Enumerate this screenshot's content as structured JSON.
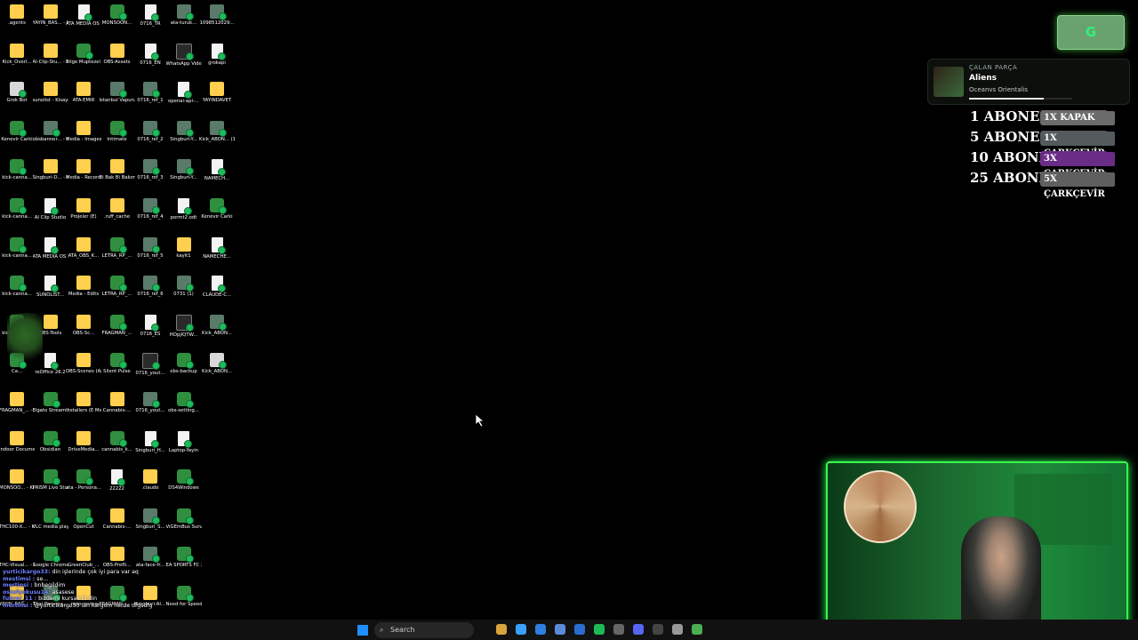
{
  "desktop": {
    "icons": [
      {
        "label": ".agents",
        "kind": "folder"
      },
      {
        "label": "YAYIN_BAS... - Kisayol",
        "kind": "folder"
      },
      {
        "label": "ATA MEDIA OS 3.0",
        "kind": "doc"
      },
      {
        "label": "MONSOON...",
        "kind": "app"
      },
      {
        "label": "0716_TR",
        "kind": "doc"
      },
      {
        "label": "ata-turuk...",
        "kind": "img"
      },
      {
        "label": "1098512029...",
        "kind": "img"
      },
      {
        "label": "Kick_Overl...",
        "kind": "folder"
      },
      {
        "label": "AI-Clip-Stu... - Kisayol",
        "kind": "folder"
      },
      {
        "label": "Bilge Muptezel ...",
        "kind": "app"
      },
      {
        "label": "OBS-Assets",
        "kind": "folder"
      },
      {
        "label": "0716_EN",
        "kind": "doc"
      },
      {
        "label": "WhatsApp Video 2026-...",
        "kind": "vid"
      },
      {
        "label": "grokapi",
        "kind": "doc"
      },
      {
        "label": "Grok Bot",
        "kind": "exe"
      },
      {
        "label": "sunolist - Kisayol",
        "kind": "folder"
      },
      {
        "label": "ATA-EMIR",
        "kind": "folder"
      },
      {
        "label": "İstanbul Vapuru",
        "kind": "img"
      },
      {
        "label": "0716_ref_1",
        "kind": "img"
      },
      {
        "label": "openai-api-...",
        "kind": "doc"
      },
      {
        "label": "YAYINDAVET",
        "kind": "folder"
      },
      {
        "label": "Kenevir Carki",
        "kind": "app"
      },
      {
        "label": "obsbanner... - Kisayol",
        "kind": "img"
      },
      {
        "label": "Media - Images",
        "kind": "folder"
      },
      {
        "label": "Intimate",
        "kind": "app"
      },
      {
        "label": "0716_ref_2",
        "kind": "img"
      },
      {
        "label": "Singburi-Y...",
        "kind": "img"
      },
      {
        "label": "Kick_ABON... (1)",
        "kind": "img"
      },
      {
        "label": "kick-canna...",
        "kind": "app"
      },
      {
        "label": "Singburi-D... - Kisayol",
        "kind": "folder"
      },
      {
        "label": "Media - Recordin...",
        "kind": "folder"
      },
      {
        "label": "Bi Bak Bi Bakım",
        "kind": "folder"
      },
      {
        "label": "0716_ref_3",
        "kind": "img"
      },
      {
        "label": "Singburi-Y...",
        "kind": "img"
      },
      {
        "label": "NAMECH...",
        "kind": "doc"
      },
      {
        "label": "kick-canna...",
        "kind": "app"
      },
      {
        "label": "AI Clip Studio",
        "kind": "doc"
      },
      {
        "label": "Projeler (E)",
        "kind": "folder"
      },
      {
        "label": ".ruff_cache",
        "kind": "folder"
      },
      {
        "label": "0716_ref_4",
        "kind": "img"
      },
      {
        "label": "pormt2.odt",
        "kind": "doc"
      },
      {
        "label": "Kenevir Carki",
        "kind": "app"
      },
      {
        "label": "kick-canna...",
        "kind": "app"
      },
      {
        "label": "ATA MEDIA OS 3.0",
        "kind": "doc"
      },
      {
        "label": "ATA_OBS_K...",
        "kind": "folder"
      },
      {
        "label": "LETRA_RP_...",
        "kind": "app"
      },
      {
        "label": "0716_ref_5",
        "kind": "img"
      },
      {
        "label": "kayit1",
        "kind": "folder"
      },
      {
        "label": "NAMECHE...",
        "kind": "doc"
      },
      {
        "label": "kick-canna...",
        "kind": "app"
      },
      {
        "label": "SUNOLIST...",
        "kind": "doc"
      },
      {
        "label": "Media - Edits",
        "kind": "folder"
      },
      {
        "label": "LETRA_RP_...",
        "kind": "app"
      },
      {
        "label": "0716_ref_6",
        "kind": "img"
      },
      {
        "label": "0731 (1)",
        "kind": "img"
      },
      {
        "label": "CLAUDE-C...",
        "kind": "doc"
      },
      {
        "label": "kick-canna...",
        "kind": "app"
      },
      {
        "label": "OBS-Tools",
        "kind": "folder"
      },
      {
        "label": "OBS-Sc...",
        "kind": "folder"
      },
      {
        "label": "FRAGMAN_...",
        "kind": "app"
      },
      {
        "label": "0716_ES",
        "kind": "doc"
      },
      {
        "label": "HOpjlQTW...",
        "kind": "vid"
      },
      {
        "label": "Kick_ABON...",
        "kind": "img"
      },
      {
        "label": "Ca...",
        "kind": "app"
      },
      {
        "label": "reOffice 26.2",
        "kind": "doc"
      },
      {
        "label": "OBS-Scenes (AppData)",
        "kind": "folder"
      },
      {
        "label": "Silent Pulse",
        "kind": "app"
      },
      {
        "label": "0716_yout...",
        "kind": "vid"
      },
      {
        "label": "obs-backup",
        "kind": "app"
      },
      {
        "label": "Kick_ABON...",
        "kind": "exe"
      },
      {
        "label": "FRAGMAN_... - Kisayol",
        "kind": "folder"
      },
      {
        "label": "Elgato Stream Deck",
        "kind": "app"
      },
      {
        "label": "Installers (E Media)",
        "kind": "folder"
      },
      {
        "label": "Cannabis-...",
        "kind": "folder"
      },
      {
        "label": "0716_yout...",
        "kind": "img"
      },
      {
        "label": "obs-setting...",
        "kind": "app"
      },
      {
        "label": "",
        "kind": "none"
      },
      {
        "label": "Indoor Document...",
        "kind": "folder"
      },
      {
        "label": "Obsidian",
        "kind": "app"
      },
      {
        "label": "DriveMedia...",
        "kind": "folder"
      },
      {
        "label": "cannabis_k...",
        "kind": "app"
      },
      {
        "label": "Singburi_H...",
        "kind": "doc"
      },
      {
        "label": "Laptop-Yayin",
        "kind": "doc"
      },
      {
        "label": "",
        "kind": "none"
      },
      {
        "label": "MONSOO... - Kisayol",
        "kind": "folder"
      },
      {
        "label": "PRISM Live Studio",
        "kind": "app"
      },
      {
        "label": "ata - Persona...",
        "kind": "app"
      },
      {
        "label": "22222",
        "kind": "doc"
      },
      {
        "label": ".claude",
        "kind": "folder"
      },
      {
        "label": "DS4Windows",
        "kind": "app"
      },
      {
        "label": "",
        "kind": "none"
      },
      {
        "label": "THC100-X... - Kisayol",
        "kind": "folder"
      },
      {
        "label": "VLC media player",
        "kind": "app"
      },
      {
        "label": "OpenCut",
        "kind": "app"
      },
      {
        "label": "Cannabis-...",
        "kind": "folder"
      },
      {
        "label": "Singburi_S...",
        "kind": "img"
      },
      {
        "label": "ViGEmBus Surucu Kur",
        "kind": "app"
      },
      {
        "label": "",
        "kind": "none"
      },
      {
        "label": "THC-Visual... - Kisayol",
        "kind": "folder"
      },
      {
        "label": "Google Chrome",
        "kind": "app"
      },
      {
        "label": "GreenClub_...",
        "kind": "folder"
      },
      {
        "label": "OBS-Prefli...",
        "kind": "folder"
      },
      {
        "label": "ata-face-fr...",
        "kind": "img"
      },
      {
        "label": "EA SPORTS FC 26",
        "kind": "app"
      },
      {
        "label": "",
        "kind": "none"
      },
      {
        "label": "YAYIN_BAS... - Kisayol",
        "kind": "folder"
      },
      {
        "label": "Thai Persona...",
        "kind": "img"
      },
      {
        "label": "_repo-review",
        "kind": "folder"
      },
      {
        "label": "FRAGMAN_... - Kisayol",
        "kind": "app"
      },
      {
        "label": "Singburi-AI...",
        "kind": "folder"
      },
      {
        "label": "Need for Speed™ Heat",
        "kind": "app"
      },
      {
        "label": "",
        "kind": "none"
      }
    ]
  },
  "overlay": {
    "top_button_label": "G",
    "now_playing": {
      "header": "ÇALAN PARÇA",
      "title": "Aliens",
      "artist": "Oceanvs Orientalis",
      "progress": 0.72
    },
    "rewards": [
      {
        "subs": "1 ABONE",
        "prize": "1X KAPAK",
        "color": "#6b6b6b"
      },
      {
        "subs": "5 ABONE",
        "prize": "1X ÇARKÇEVİR",
        "color": "#555a5c"
      },
      {
        "subs": "10 ABONE",
        "prize": "3X ÇARKÇEVİR",
        "color": "#6a2c86"
      },
      {
        "subs": "25 ABONE",
        "prize": "5X ÇARKÇEVİR",
        "color": "#5f5f5f"
      }
    ]
  },
  "chat": [
    {
      "user": "yurticikargo33:",
      "text": "din işlerinde çok iyi para var aq"
    },
    {
      "user": "mestimsi :",
      "text": "se..."
    },
    {
      "user": "mertinsi :",
      "text": "bnbegildim"
    },
    {
      "user": "ostafyokusu14:",
      "text": "asasese"
    },
    {
      "user": "fuhrer_11 :",
      "text": "bizdemi kursak bi din"
    },
    {
      "user": "mertinsi :",
      "text": "@yurticikargo33 lan kargom nerde dfgsdfg"
    }
  ],
  "taskbar": {
    "search_placeholder": "Search",
    "apps": [
      "file-manager-icon",
      "chrome-icon",
      "edge-icon",
      "store-icon",
      "mail-icon",
      "spotify-icon",
      "obs-icon",
      "discord-icon",
      "terminal-icon",
      "settings-icon",
      "media-icon"
    ]
  },
  "colors": {
    "accent_green": "#36ff4e",
    "chat_user": "#6f7dff",
    "reward_prize_colors": [
      "#6b6b6b",
      "#555a5c",
      "#6a2c86",
      "#5f5f5f"
    ]
  }
}
